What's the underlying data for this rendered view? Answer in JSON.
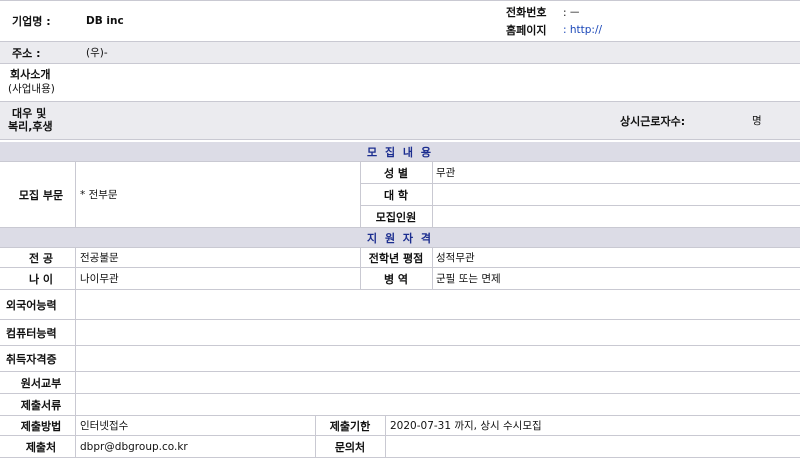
{
  "company": {
    "name_label": "기업명 :",
    "name_value": "DB inc",
    "phone_label": "전화번호",
    "phone_value": ": ㅡ",
    "homepage_label": "홈페이지",
    "homepage_value": ": http://",
    "address_label": "주소 :",
    "address_value": "(우)-",
    "intro_label_1": "회사소개",
    "intro_label_2": "(사업내용)",
    "benefit_label_1": "대우 및",
    "benefit_label_2": "복리,후생",
    "employees_label": "상시근로자수:",
    "employees_unit": "명"
  },
  "recruit": {
    "section_title": "모 집 내 용",
    "dept_label": "모집 부문",
    "dept_value": "* 전부문",
    "gender_label": "성 별",
    "gender_value": "무관",
    "college_label": "대 학",
    "college_value": "",
    "headcount_label": "모집인원",
    "headcount_value": ""
  },
  "qualification": {
    "section_title": "지 원 자 격",
    "major_label": "전 공",
    "major_value": "전공불문",
    "gpa_label": "전학년 평점",
    "gpa_value": "성적무관",
    "age_label": "나 이",
    "age_value": "나이무관",
    "military_label": "병 역",
    "military_value": "군필 또는 면제",
    "language_label": "외국어능력",
    "computer_label": "컴퓨터능력",
    "license_label": "취득자격증",
    "form_label": "원서교부",
    "docs_label": "제출서류",
    "method_label": "제출방법",
    "method_value": "인터넷접수",
    "deadline_label": "제출기한",
    "deadline_value": "2020-07-31 까지, 상시 수시모집",
    "submit_to_label": "제출처",
    "submit_to_value": "dbpr@dbgroup.co.kr",
    "contact_label": "문의처",
    "contact_value": ""
  }
}
